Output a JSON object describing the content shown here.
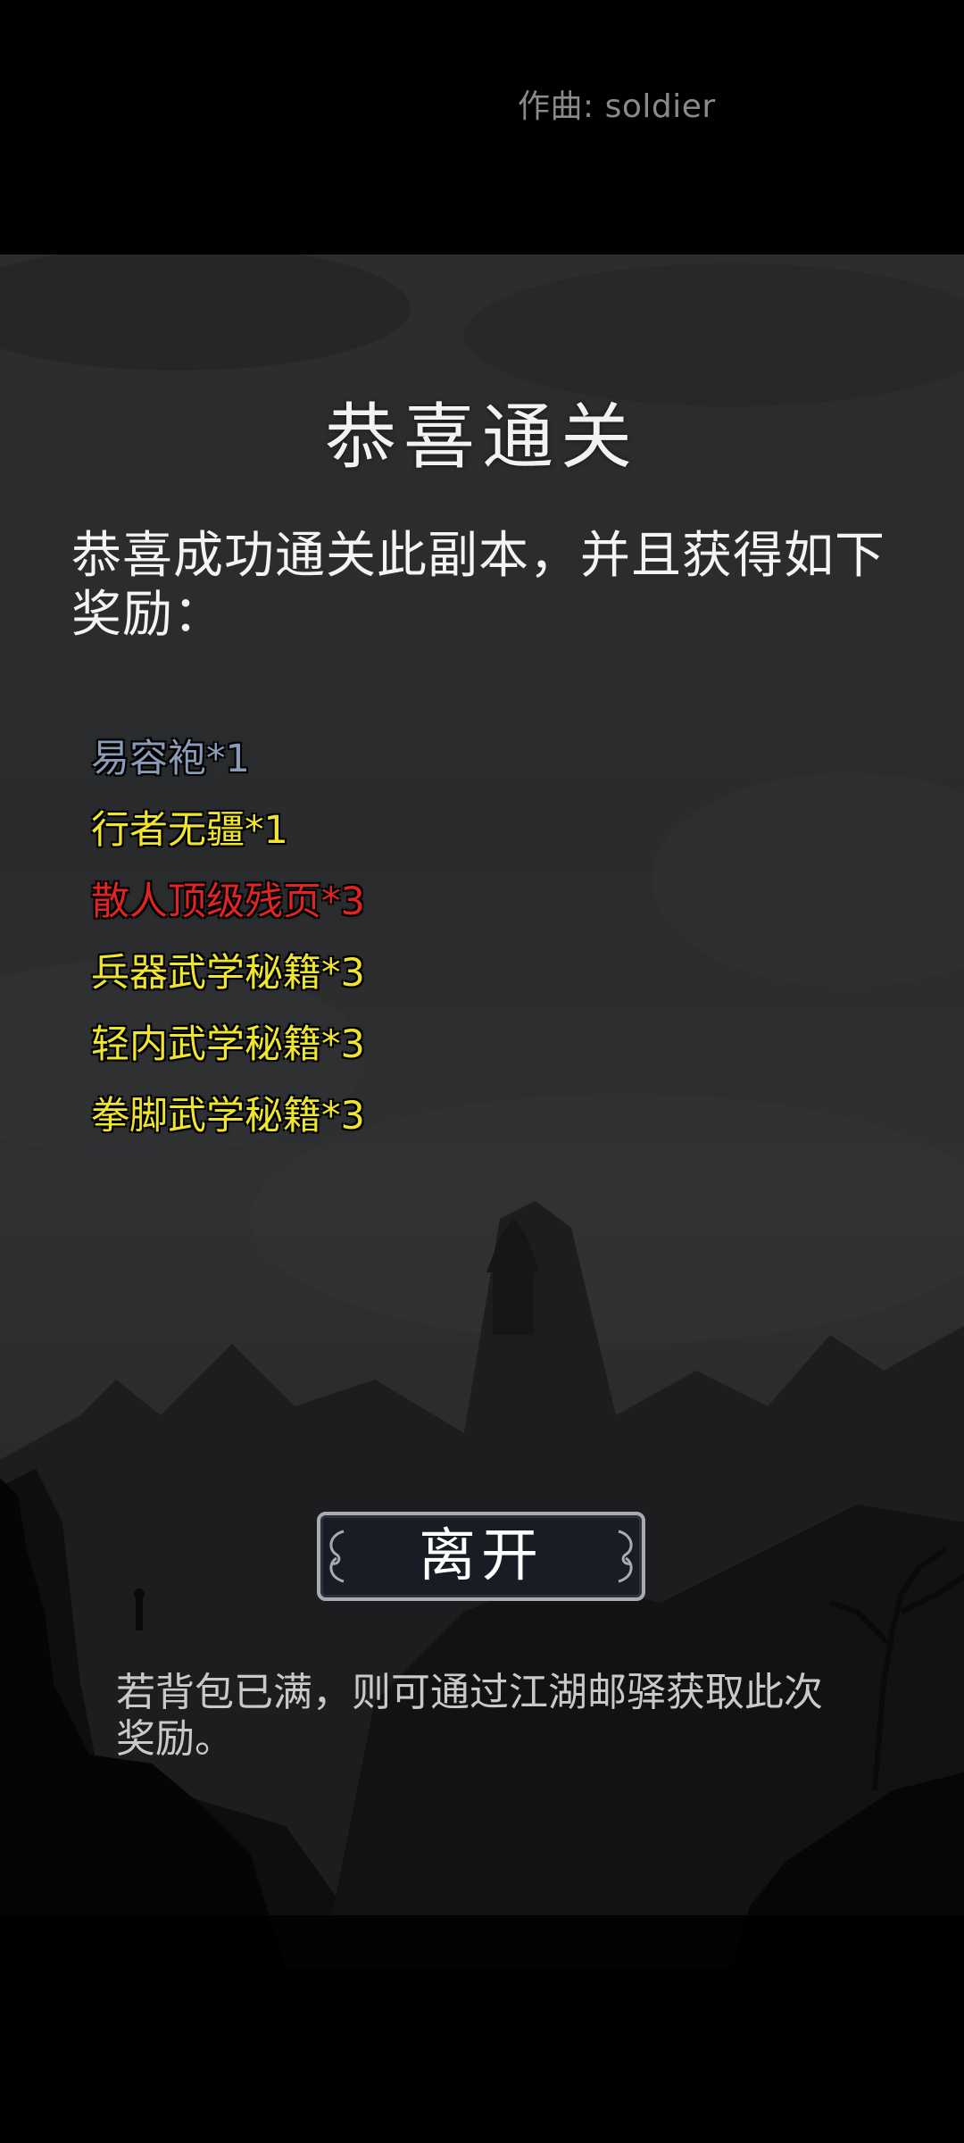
{
  "header": {
    "credit": "作曲: soldier"
  },
  "dialog": {
    "title": "恭喜通关",
    "message": "恭喜成功通关此副本，并且获得如下奖励：",
    "rewards": [
      {
        "label": "易容袍*1",
        "color": "#8a9bb8"
      },
      {
        "label": "行者无疆*1",
        "color": "#f0e52e"
      },
      {
        "label": "散人顶级残页*3",
        "color": "#e02424"
      },
      {
        "label": "兵器武学秘籍*3",
        "color": "#f0e52e"
      },
      {
        "label": "轻内武学秘籍*3",
        "color": "#f0e52e"
      },
      {
        "label": "拳脚武学秘籍*3",
        "color": "#f0e52e"
      }
    ],
    "leave_button": "离开",
    "note": "若背包已满，则可通过江湖邮驿获取此次奖励。"
  },
  "icons": {
    "button_ornament": "scroll-ornament-icon"
  }
}
